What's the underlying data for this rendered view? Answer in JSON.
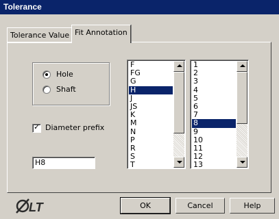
{
  "window": {
    "title": "Tolerance"
  },
  "tabs": [
    {
      "label": "Tolerance Value",
      "selected": false
    },
    {
      "label": "Fit Annotation",
      "selected": true
    }
  ],
  "position": {
    "options": [
      {
        "label": "Hole",
        "selected": true
      },
      {
        "label": "Shaft",
        "selected": false
      }
    ]
  },
  "diameter_prefix": {
    "label": "Diameter prefix",
    "checked": true
  },
  "fit_value": "H8",
  "letter_list": {
    "items": [
      "F",
      "FG",
      "G",
      "H",
      "J",
      "JS",
      "K",
      "M",
      "N",
      "P",
      "R",
      "S",
      "T"
    ],
    "selected": "H"
  },
  "grade_list": {
    "items": [
      "1",
      "2",
      "3",
      "4",
      "5",
      "6",
      "7",
      "8",
      "9",
      "10",
      "11",
      "12",
      "13"
    ],
    "selected": "8"
  },
  "buttons": {
    "ok": "OK",
    "cancel": "Cancel",
    "help": "Help"
  },
  "logo": {
    "icon": "autocad-lt-logo",
    "text": "LT"
  },
  "colors": {
    "selection": "#0a246a",
    "face": "#d4d0c8",
    "title_bar": "#0a246a"
  }
}
